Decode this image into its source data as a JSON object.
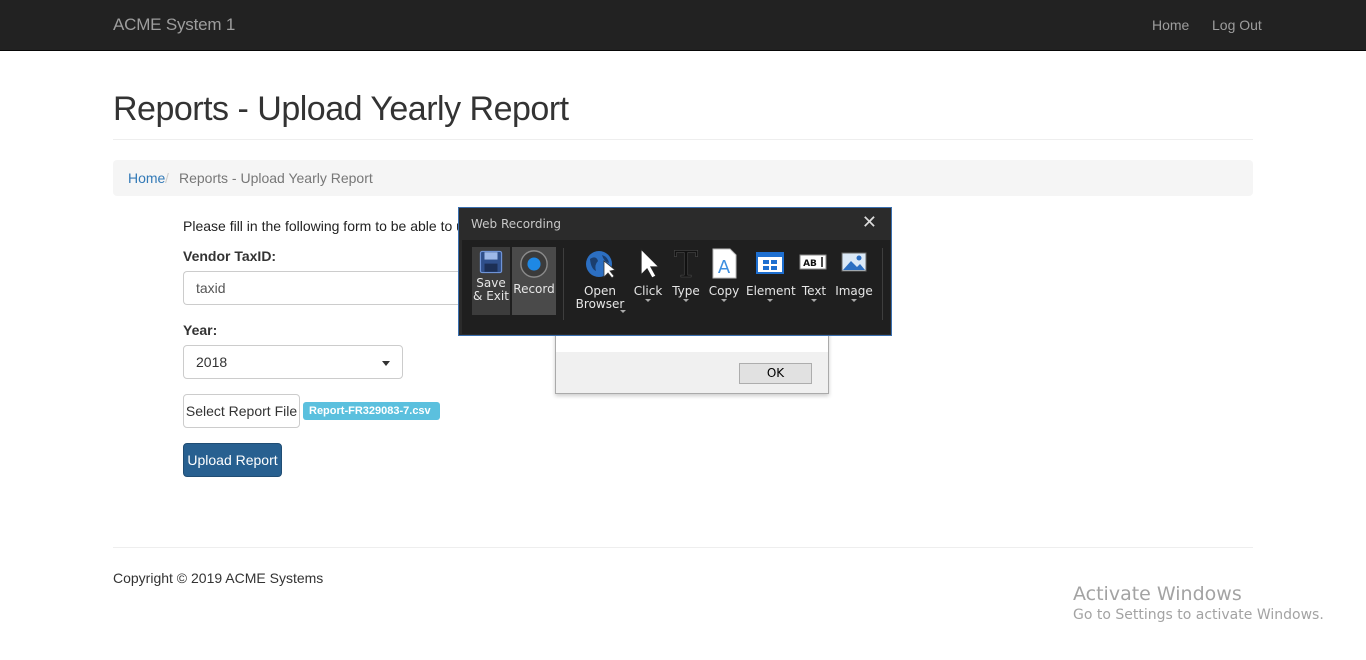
{
  "navbar": {
    "brand": "ACME System 1",
    "links": [
      "Home",
      "Log Out"
    ]
  },
  "page": {
    "title": "Reports - Upload Yearly Report",
    "breadcrumb": {
      "home": "Home",
      "separator": "/",
      "current": "Reports - Upload Yearly Report"
    }
  },
  "form": {
    "intro": "Please fill in the following form to be able to upload a",
    "vendor_label": "Vendor TaxID:",
    "vendor_value": "taxid",
    "year_label": "Year:",
    "year_value": "2018",
    "select_file_label": "Select Report File",
    "file_badge": "Report-FR329083-7.csv",
    "upload_label": "Upload Report"
  },
  "footer": {
    "copyright": "Copyright © 2019 ACME Systems"
  },
  "watermark": {
    "title": "Activate Windows",
    "subtitle": "Go to Settings to activate Windows."
  },
  "dialog": {
    "ok_label": "OK"
  },
  "recorder": {
    "title": "Web Recording",
    "close_glyph": "✕",
    "tools": [
      {
        "icon": "save-icon",
        "label_line1": "Save",
        "label_line2": "& Exit"
      },
      {
        "icon": "record-icon",
        "label_line1": "Record"
      },
      {
        "icon": "globe-icon",
        "label_line1": "Open",
        "label_line2": "Browser"
      },
      {
        "icon": "cursor-icon",
        "label_line1": "Click"
      },
      {
        "icon": "type-icon",
        "label_line1": "Type"
      },
      {
        "icon": "copy-icon",
        "label_line1": "Copy"
      },
      {
        "icon": "element-icon",
        "label_line1": "Element"
      },
      {
        "icon": "text-icon",
        "label_line1": "Text"
      },
      {
        "icon": "image-icon",
        "label_line1": "Image"
      }
    ]
  },
  "colors": {
    "navbar_bg": "#222222",
    "link_blue": "#337ab7",
    "primary_btn": "#286090",
    "file_badge": "#5bc0de",
    "recorder_bg": "#2b2b2b",
    "recorder_accent": "#3a6fb0"
  }
}
